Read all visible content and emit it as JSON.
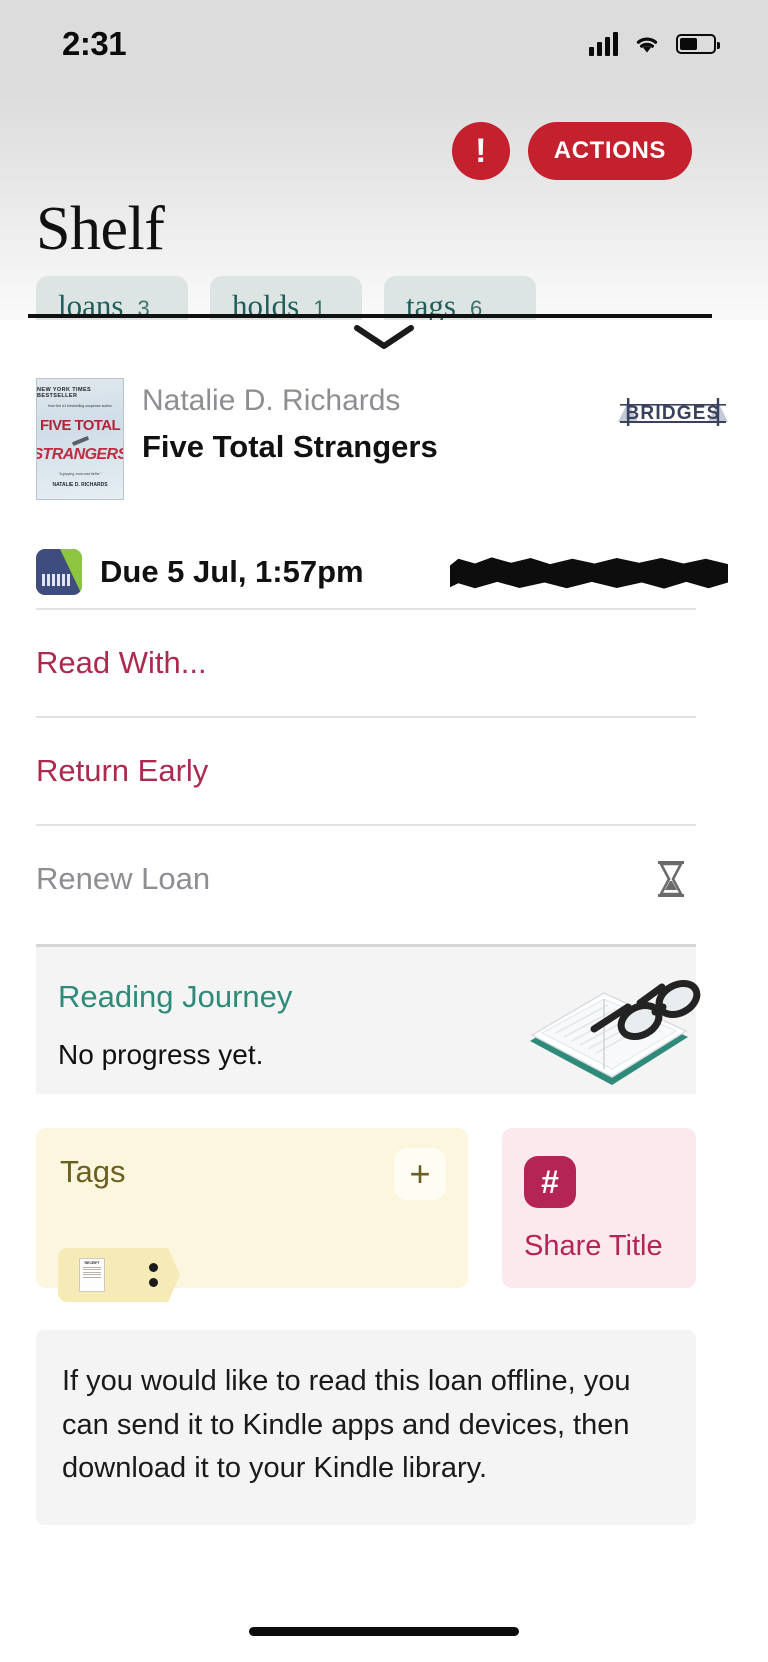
{
  "status_bar": {
    "time": "2:31",
    "signal_icon": "cellular-bars-icon",
    "wifi_icon": "wifi-icon",
    "battery_icon": "battery-icon"
  },
  "header": {
    "title": "Shelf",
    "alert_label": "!",
    "actions_label": "ACTIONS",
    "accent_color": "#c5202e"
  },
  "tabs": [
    {
      "label": "loans",
      "count": "3"
    },
    {
      "label": "holds",
      "count": "1"
    },
    {
      "label": "tags",
      "count": "6"
    }
  ],
  "collapse_chevron": "chevron-down-icon",
  "book": {
    "author": "Natalie D. Richards",
    "title": "Five Total Strangers",
    "library_name": "BRIDGES",
    "cover": {
      "banner": "NEW YORK TIMES BESTSELLER",
      "tagline": "from the #1 bestselling suspense author",
      "title_line1": "FIVE TOTAL",
      "title_line2": "STRANGERS",
      "blurb": "\"A gripping, must-read thriller.\"",
      "author": "NATALIE D. RICHARDS"
    }
  },
  "loan": {
    "format_icon": "ebook-format-icon",
    "due_text": "Due 5 Jul, 1:57pm",
    "redacted_note": "redacted-text-block"
  },
  "actions": [
    {
      "label": "Read With...",
      "style": "link",
      "icon": null
    },
    {
      "label": "Return Early",
      "style": "link",
      "icon": null
    },
    {
      "label": "Renew Loan",
      "style": "muted",
      "icon": "hourglass-icon"
    }
  ],
  "reading_journey": {
    "title": "Reading Journey",
    "subtitle": "No progress yet.",
    "art": "open-book-with-glasses-illustration",
    "accent_color": "#2f8a79"
  },
  "tags_card": {
    "title": "Tags",
    "add_label": "+",
    "chip_icon": "receipt-thumbnail",
    "chip_menu": "more-dots-icon",
    "background_color": "#fbf6dd"
  },
  "share_card": {
    "icon": "#",
    "label": "Share Title",
    "background_color": "#fbe9ee",
    "accent_color": "#b42454"
  },
  "info_panel": {
    "text": "If you would like to read this loan offline, you can send it to Kindle apps and devices, then download it to your Kindle library."
  }
}
